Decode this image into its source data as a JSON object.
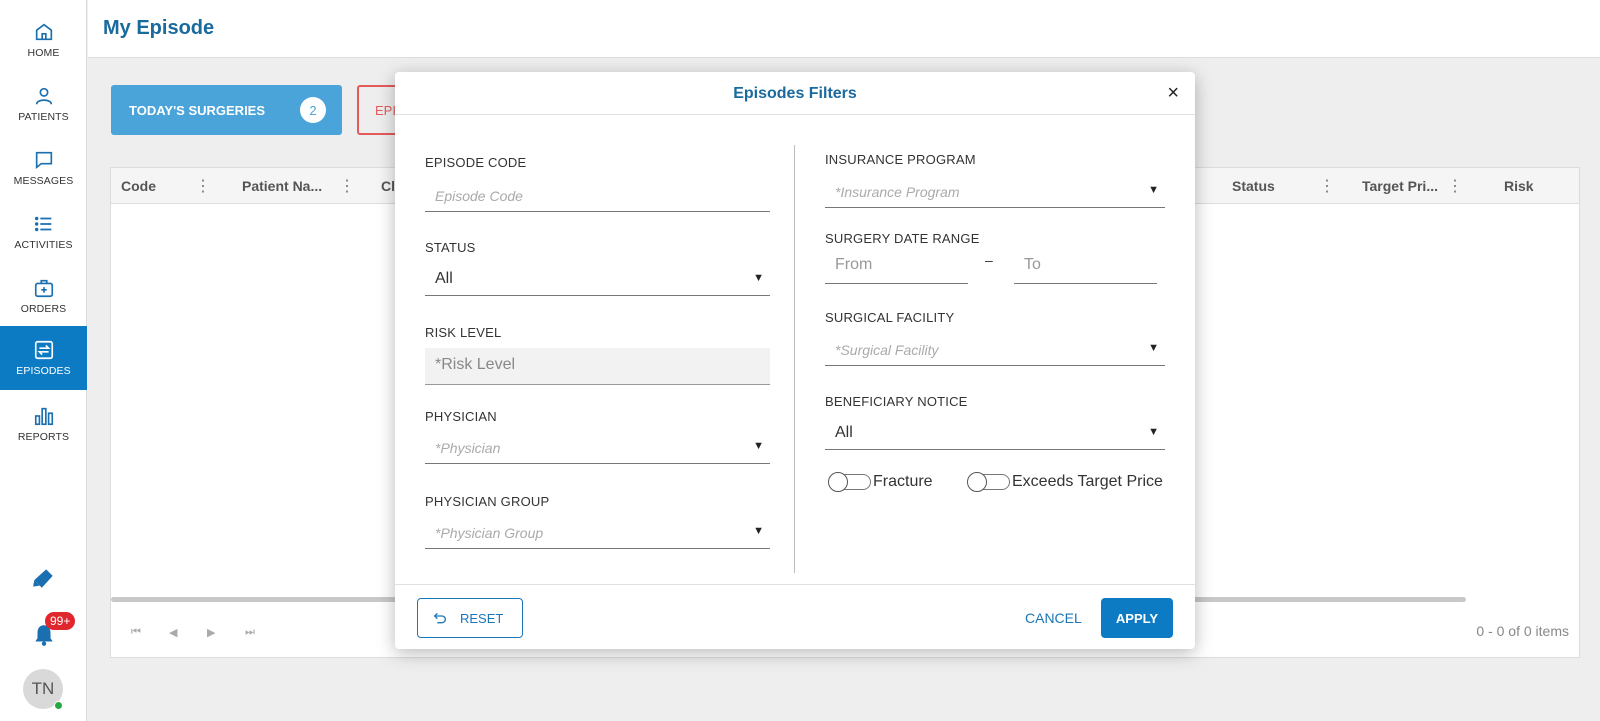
{
  "sidebar": {
    "items": [
      {
        "label": "HOME",
        "icon": "home-icon"
      },
      {
        "label": "PATIENTS",
        "icon": "person-icon"
      },
      {
        "label": "MESSAGES",
        "icon": "chat-icon"
      },
      {
        "label": "ACTIVITIES",
        "icon": "list-icon"
      },
      {
        "label": "ORDERS",
        "icon": "medical-bag-icon"
      },
      {
        "label": "EPISODES",
        "icon": "episodes-icon"
      },
      {
        "label": "REPORTS",
        "icon": "bar-chart-icon"
      }
    ],
    "active": "EPISODES",
    "notification_badge": "99+",
    "avatar_initials": "TN"
  },
  "header": {
    "title": "My Episode"
  },
  "tabs": {
    "today_label": "TODAY'S SURGERIES",
    "today_count": "2",
    "episodes_partial_label": "EPI"
  },
  "grid": {
    "columns": [
      {
        "label": "Code"
      },
      {
        "label": "Patient Na..."
      },
      {
        "label": "Cl"
      },
      {
        "label": "Status"
      },
      {
        "label": "Target Pri..."
      },
      {
        "label": "Risk"
      }
    ],
    "pager_info": "0 - 0 of 0 items"
  },
  "modal": {
    "title": "Episodes Filters",
    "close_symbol": "×",
    "episode_code": {
      "label": "EPISODE CODE",
      "placeholder": "Episode Code"
    },
    "status": {
      "label": "STATUS",
      "value": "All"
    },
    "risk_level": {
      "label": "RISK LEVEL",
      "placeholder": "*Risk Level"
    },
    "physician": {
      "label": "PHYSICIAN",
      "placeholder": "*Physician"
    },
    "physician_group": {
      "label": "PHYSICIAN GROUP",
      "placeholder": "*Physician Group"
    },
    "insurance_program": {
      "label": "INSURANCE PROGRAM",
      "placeholder": "*Insurance Program"
    },
    "surgery_date_range": {
      "label": "SURGERY DATE RANGE",
      "from_placeholder": "From",
      "separator": "–",
      "to_placeholder": "To"
    },
    "surgical_facility": {
      "label": "SURGICAL FACILITY",
      "placeholder": "*Surgical Facility"
    },
    "beneficiary_notice": {
      "label": "BENEFICIARY NOTICE",
      "value": "All"
    },
    "fracture_label": "Fracture",
    "exceeds_label": "Exceeds Target Price",
    "reset_label": "RESET",
    "cancel_label": "CANCEL",
    "apply_label": "APPLY"
  },
  "colors": {
    "accent": "#0c7bc4",
    "title": "#1a6a9e",
    "today_tab": "#4aa3d9",
    "episodes_tab": "#e35b5b",
    "badge": "#e0272d"
  }
}
